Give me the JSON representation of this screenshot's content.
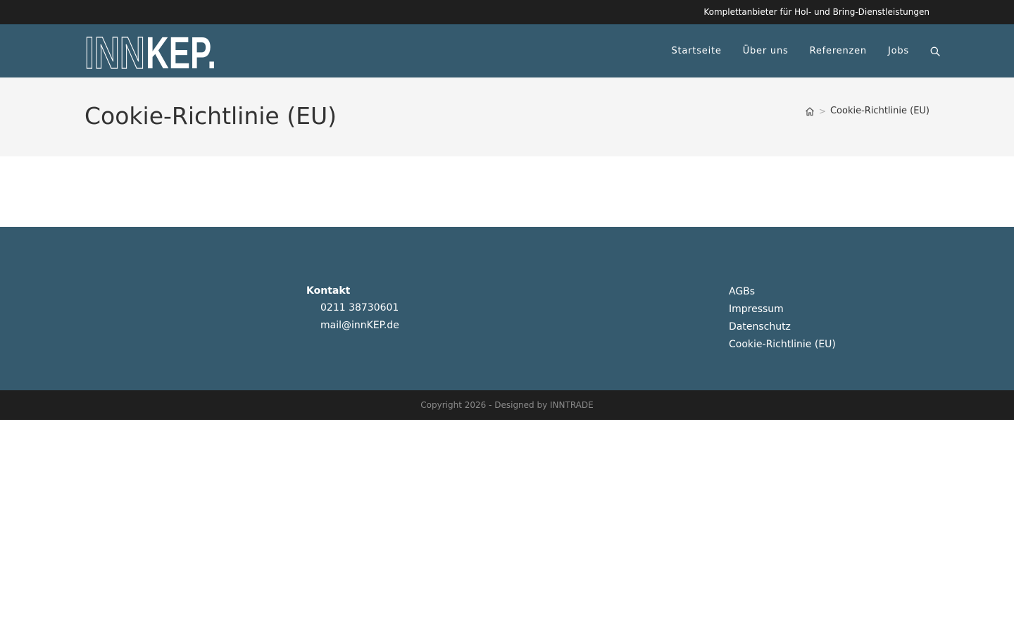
{
  "topbar": {
    "text": "Komplettanbieter für Hol- und Bring-Dienstleistungen"
  },
  "header": {
    "logo": {
      "part1": "INN",
      "part2": "KEP."
    },
    "nav": [
      {
        "label": "Startseite"
      },
      {
        "label": "Über uns"
      },
      {
        "label": "Referenzen"
      },
      {
        "label": "Jobs"
      }
    ],
    "search_icon": "search-icon"
  },
  "title_bar": {
    "title": "Cookie-Richtlinie (EU)",
    "breadcrumb": {
      "home_icon": "home-icon",
      "separator": ">",
      "current": "Cookie-Richtlinie (EU)"
    }
  },
  "footer": {
    "contact": {
      "heading": "Kontakt",
      "phone": "0211 38730601",
      "email": "mail@innKEP.de"
    },
    "links": [
      {
        "label": "AGBs"
      },
      {
        "label": "Impressum"
      },
      {
        "label": "Datenschutz"
      },
      {
        "label": "Cookie-Richtlinie (EU)"
      }
    ]
  },
  "copyright": {
    "text": "Copyright 2026 - Designed by INNTRADE"
  },
  "colors": {
    "topbar": "#1f1f1f",
    "header": "#355a6e",
    "title_bar": "#f5f5f5",
    "footer": "#355a6e",
    "copyright_bar": "#1f1f1f"
  }
}
